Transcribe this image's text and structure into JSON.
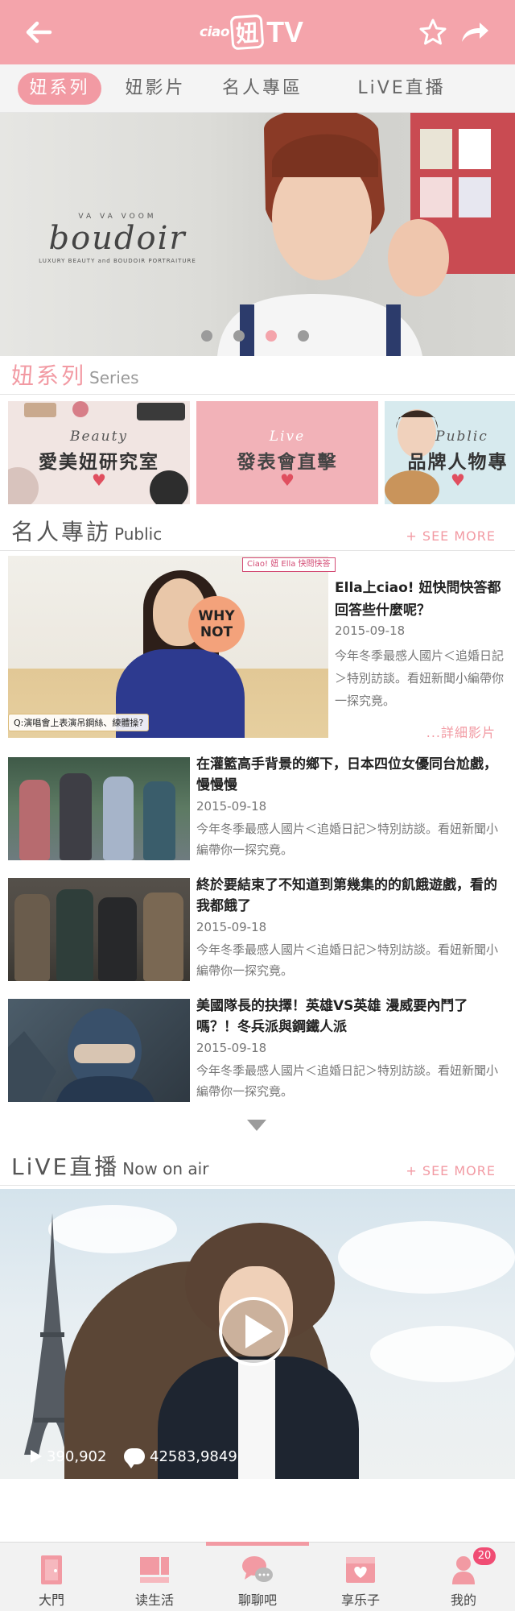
{
  "header": {
    "logo_small": "ciao",
    "logo_char": "妞",
    "logo_tv": "TV"
  },
  "tabs": [
    {
      "label": "妞系列",
      "active": true
    },
    {
      "label": "妞影片",
      "active": false
    },
    {
      "label": "名人專區",
      "active": false
    },
    {
      "label": "LiVE直播",
      "active": false
    }
  ],
  "hero": {
    "brand_top": "VA VA VOOM",
    "brand_name": "boudoir",
    "brand_sub": "LUXURY BEAUTY and BOUDOIR PORTRAITURE",
    "slide_count": 4,
    "active_slide": 3
  },
  "series": {
    "title": "妞系列",
    "subtitle": "Series",
    "cards": [
      {
        "tag": "Beauty",
        "title": "愛美妞研究室"
      },
      {
        "tag": "Live",
        "title": "發表會直擊"
      },
      {
        "tag": "Public",
        "title": "品牌人物專"
      }
    ]
  },
  "public": {
    "title": "名人專訪",
    "subtitle": "Public",
    "see_more": "+ SEE MORE",
    "featured": {
      "badge": "Ciao! 妞 Ella 快問快答",
      "sign_text": "WHY NOT",
      "caption": "Q:演唱會上表演吊鋼絲、練體操?",
      "title": "Ella上ciao! 妞快問快答都回答些什麼呢？",
      "date": "2015-09-18",
      "desc": "今年冬季最感人國片＜追婚日記＞特別訪談。看妞新聞小編帶你一探究竟。",
      "more": "...詳細影片"
    },
    "items": [
      {
        "title": "在灌籃高手背景的鄉下，日本四位女優同台尬戲，慢慢慢",
        "date": "2015-09-18",
        "desc": "今年冬季最感人國片＜追婚日記＞特別訪談。看妞新聞小編帶你一探究竟。"
      },
      {
        "title": "終於要結束了不知道到第幾集的的飢餓遊戲，看的我都餓了",
        "date": "2015-09-18",
        "desc": "今年冬季最感人國片＜追婚日記＞特別訪談。看妞新聞小編帶你一探究竟。"
      },
      {
        "title": "美國隊長的抉擇！英雄VS英雄 漫威要內鬥了嗎？！冬兵派與鋼鐵人派",
        "date": "2015-09-18",
        "desc": "今年冬季最感人國片＜追婚日記＞特別訪談。看妞新聞小編帶你一探究竟。"
      }
    ]
  },
  "live": {
    "title": "LiVE直播",
    "subtitle": "Now on air",
    "see_more": "+ SEE MORE",
    "views": "390,902",
    "comments": "42583,9849"
  },
  "bottom_nav": [
    {
      "label": "大門",
      "icon": "door-icon",
      "active": false
    },
    {
      "label": "读生活",
      "icon": "layout-icon",
      "active": false
    },
    {
      "label": "聊聊吧",
      "icon": "chat-icon",
      "active": true
    },
    {
      "label": "享乐子",
      "icon": "heart-card-icon",
      "active": false
    },
    {
      "label": "我的",
      "icon": "user-icon",
      "active": false,
      "badge": "20"
    }
  ],
  "colors": {
    "brand_pink": "#f4a4ab",
    "accent_pink": "#f29aa3",
    "badge_red": "#f04d74"
  }
}
